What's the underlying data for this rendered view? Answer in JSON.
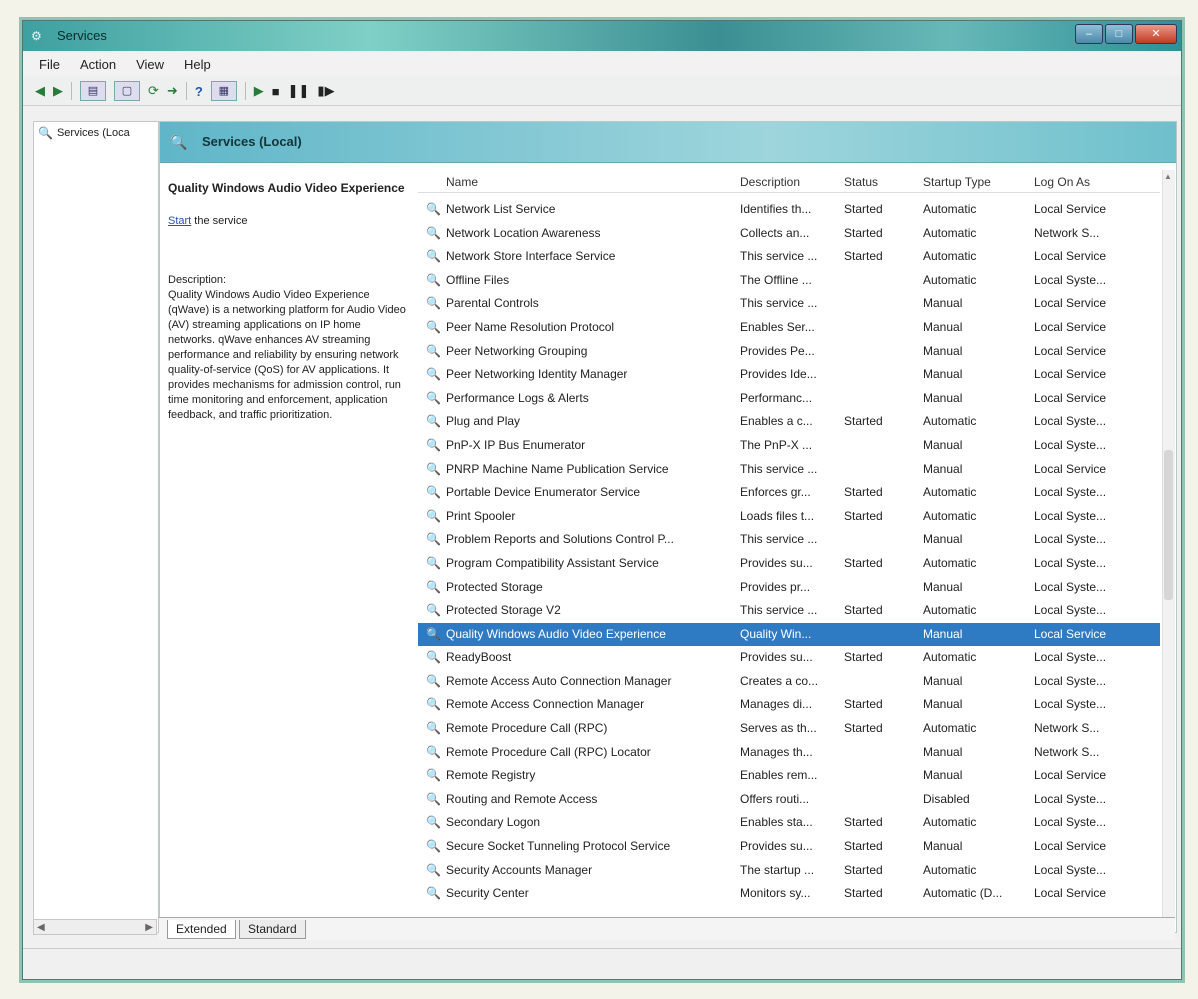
{
  "window": {
    "title": "Services"
  },
  "menu": [
    "File",
    "Action",
    "View",
    "Help"
  ],
  "tree": {
    "item": "Services (Loca"
  },
  "header": {
    "title": "Services (Local)"
  },
  "details": {
    "service_name": "Quality Windows Audio Video Experience",
    "start_link": "Start",
    "start_suffix": " the service",
    "description_label": "Description:",
    "description": "Quality Windows Audio Video Experience (qWave) is a networking platform for Audio Video (AV) streaming applications on IP home networks. qWave enhances AV streaming performance and reliability by ensuring network quality-of-service (QoS) for AV applications. It provides mechanisms for admission control, run time monitoring and enforcement, application feedback, and traffic prioritization."
  },
  "columns": {
    "name": "Name",
    "description": "Description",
    "status": "Status",
    "startup": "Startup Type",
    "logon": "Log On As"
  },
  "services": [
    {
      "name": "Network List Service",
      "desc": "Identifies th...",
      "status": "Started",
      "startup": "Automatic",
      "logon": "Local Service"
    },
    {
      "name": "Network Location Awareness",
      "desc": "Collects an...",
      "status": "Started",
      "startup": "Automatic",
      "logon": "Network S..."
    },
    {
      "name": "Network Store Interface Service",
      "desc": "This service ...",
      "status": "Started",
      "startup": "Automatic",
      "logon": "Local Service"
    },
    {
      "name": "Offline Files",
      "desc": "The Offline ...",
      "status": "",
      "startup": "Automatic",
      "logon": "Local Syste..."
    },
    {
      "name": "Parental Controls",
      "desc": "This service ...",
      "status": "",
      "startup": "Manual",
      "logon": "Local Service"
    },
    {
      "name": "Peer Name Resolution Protocol",
      "desc": "Enables Ser...",
      "status": "",
      "startup": "Manual",
      "logon": "Local Service"
    },
    {
      "name": "Peer Networking Grouping",
      "desc": "Provides Pe...",
      "status": "",
      "startup": "Manual",
      "logon": "Local Service"
    },
    {
      "name": "Peer Networking Identity Manager",
      "desc": "Provides Ide...",
      "status": "",
      "startup": "Manual",
      "logon": "Local Service"
    },
    {
      "name": "Performance Logs & Alerts",
      "desc": "Performanc...",
      "status": "",
      "startup": "Manual",
      "logon": "Local Service"
    },
    {
      "name": "Plug and Play",
      "desc": "Enables a c...",
      "status": "Started",
      "startup": "Automatic",
      "logon": "Local Syste..."
    },
    {
      "name": "PnP-X IP Bus Enumerator",
      "desc": "The PnP-X ...",
      "status": "",
      "startup": "Manual",
      "logon": "Local Syste..."
    },
    {
      "name": "PNRP Machine Name Publication Service",
      "desc": "This service ...",
      "status": "",
      "startup": "Manual",
      "logon": "Local Service"
    },
    {
      "name": "Portable Device Enumerator Service",
      "desc": "Enforces gr...",
      "status": "Started",
      "startup": "Automatic",
      "logon": "Local Syste..."
    },
    {
      "name": "Print Spooler",
      "desc": "Loads files t...",
      "status": "Started",
      "startup": "Automatic",
      "logon": "Local Syste..."
    },
    {
      "name": "Problem Reports and Solutions Control P...",
      "desc": "This service ...",
      "status": "",
      "startup": "Manual",
      "logon": "Local Syste..."
    },
    {
      "name": "Program Compatibility Assistant Service",
      "desc": "Provides su...",
      "status": "Started",
      "startup": "Automatic",
      "logon": "Local Syste..."
    },
    {
      "name": "Protected Storage",
      "desc": "Provides pr...",
      "status": "",
      "startup": "Manual",
      "logon": "Local Syste..."
    },
    {
      "name": "Protected Storage V2",
      "desc": "This service ...",
      "status": "Started",
      "startup": "Automatic",
      "logon": "Local Syste..."
    },
    {
      "name": "Quality Windows Audio Video Experience",
      "desc": "Quality Win...",
      "status": "",
      "startup": "Manual",
      "logon": "Local Service",
      "selected": true
    },
    {
      "name": "ReadyBoost",
      "desc": "Provides su...",
      "status": "Started",
      "startup": "Automatic",
      "logon": "Local Syste..."
    },
    {
      "name": "Remote Access Auto Connection Manager",
      "desc": "Creates a co...",
      "status": "",
      "startup": "Manual",
      "logon": "Local Syste..."
    },
    {
      "name": "Remote Access Connection Manager",
      "desc": "Manages di...",
      "status": "Started",
      "startup": "Manual",
      "logon": "Local Syste..."
    },
    {
      "name": "Remote Procedure Call (RPC)",
      "desc": "Serves as th...",
      "status": "Started",
      "startup": "Automatic",
      "logon": "Network S..."
    },
    {
      "name": "Remote Procedure Call (RPC) Locator",
      "desc": "Manages th...",
      "status": "",
      "startup": "Manual",
      "logon": "Network S..."
    },
    {
      "name": "Remote Registry",
      "desc": "Enables rem...",
      "status": "",
      "startup": "Manual",
      "logon": "Local Service"
    },
    {
      "name": "Routing and Remote Access",
      "desc": "Offers routi...",
      "status": "",
      "startup": "Disabled",
      "logon": "Local Syste..."
    },
    {
      "name": "Secondary Logon",
      "desc": "Enables sta...",
      "status": "Started",
      "startup": "Automatic",
      "logon": "Local Syste..."
    },
    {
      "name": "Secure Socket Tunneling Protocol Service",
      "desc": "Provides su...",
      "status": "Started",
      "startup": "Manual",
      "logon": "Local Service"
    },
    {
      "name": "Security Accounts Manager",
      "desc": "The startup ...",
      "status": "Started",
      "startup": "Automatic",
      "logon": "Local Syste..."
    },
    {
      "name": "Security Center",
      "desc": "Monitors sy...",
      "status": "Started",
      "startup": "Automatic (D...",
      "logon": "Local Service"
    }
  ],
  "tabs": [
    "Extended",
    "Standard"
  ]
}
